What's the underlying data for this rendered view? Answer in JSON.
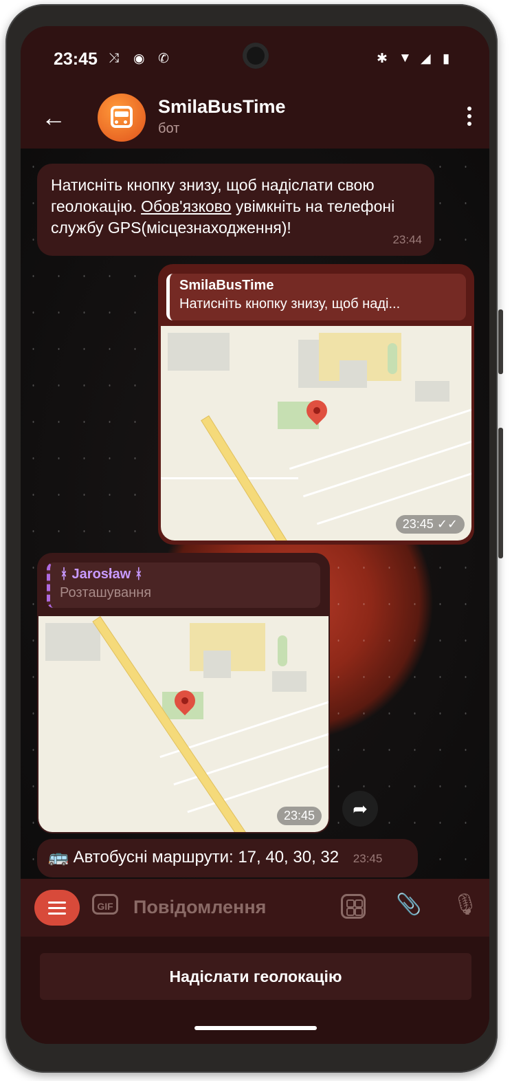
{
  "status_bar": {
    "time": "23:45"
  },
  "header": {
    "title": "SmilaBusTime",
    "subtitle": "бот"
  },
  "messages": {
    "bot_prompt": {
      "text_before": "Натисніть кнопку знизу, щоб надіслати свою геолокацію.",
      "text_underlined": "Обов'язково",
      "text_after": "увімкніть на телефоні службу GPS(місцезнаходження)!",
      "time": "23:44"
    },
    "user_location": {
      "reply_title": "SmilaBusTime",
      "reply_text": "Натисніть кнопку знизу, щоб наді...",
      "time": "23:45",
      "check_icon": "double-check-icon"
    },
    "forwarded_location": {
      "reply_title": "ᚼ Jarosław ᚼ",
      "reply_text": "Розташування",
      "time": "23:45"
    },
    "routes": {
      "emoji": "🚌",
      "text": "Автобусні маршрути: 17, 40, 30, 32",
      "time": "23:45"
    }
  },
  "input_bar": {
    "placeholder": "Повідомлення",
    "gif_label": "GIF"
  },
  "keyboard": {
    "button_label": "Надіслати геолокацію"
  },
  "colors": {
    "accent": "#d84a3a",
    "bubble_out": "#5a1a16",
    "bubble_in": "#3a1818"
  }
}
